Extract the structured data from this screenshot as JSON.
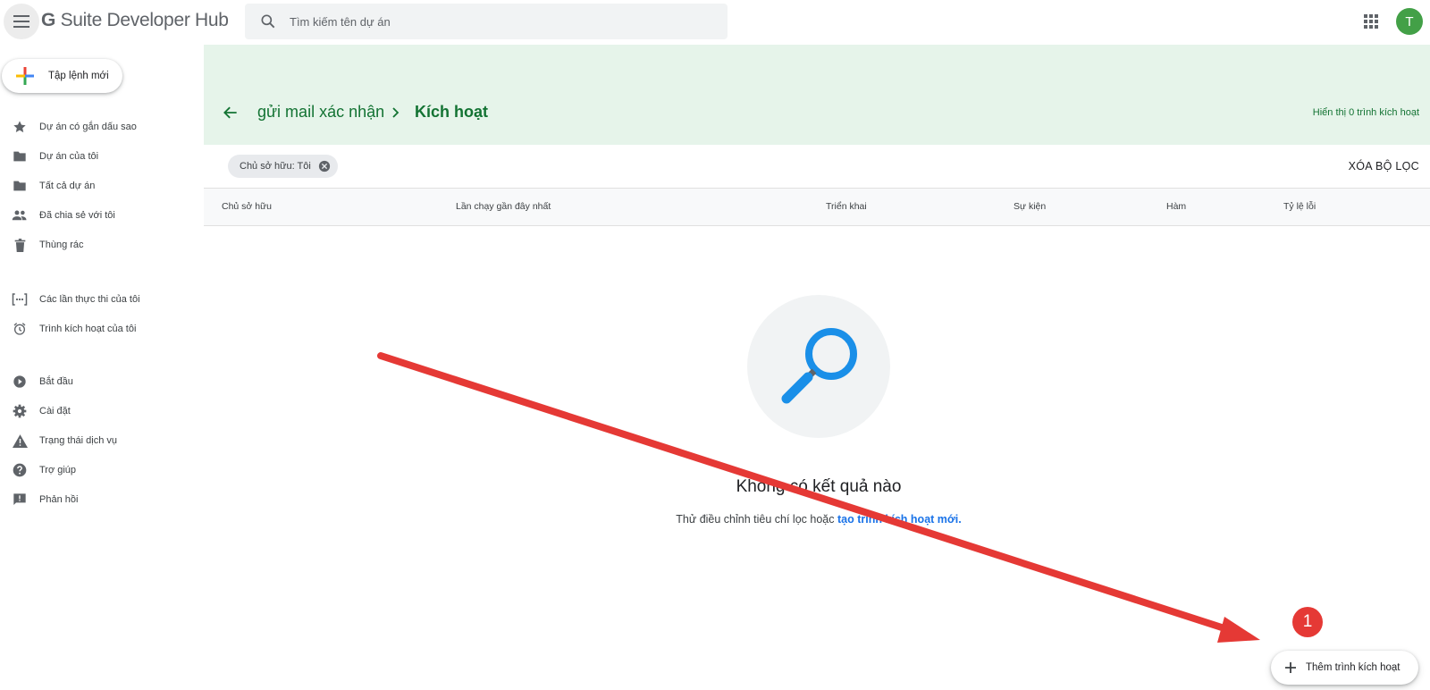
{
  "app": {
    "brand_prefix": "G",
    "brand_name": "Suite Developer Hub",
    "search_placeholder": "Tìm kiếm tên dự án",
    "avatar_initial": "T"
  },
  "sidebar": {
    "new_button_label": "Tập lệnh mới",
    "items": [
      {
        "label": "Dự án có gắn dấu sao",
        "icon": "star-icon"
      },
      {
        "label": "Dự án của tôi",
        "icon": "folder-icon"
      },
      {
        "label": "Tất cả dự án",
        "icon": "folder-icon"
      },
      {
        "label": "Đã chia sẻ với tôi",
        "icon": "people-icon"
      },
      {
        "label": "Thùng rác",
        "icon": "trash-icon"
      },
      {
        "label": "Các lần thực thi của tôi",
        "icon": "executions-icon"
      },
      {
        "label": "Trình kích hoạt của tôi",
        "icon": "alarm-icon"
      },
      {
        "label": "Bắt đầu",
        "icon": "play-circle-icon"
      },
      {
        "label": "Cài đặt",
        "icon": "gear-icon"
      },
      {
        "label": "Trạng thái dịch vụ",
        "icon": "warning-icon"
      },
      {
        "label": "Trợ giúp",
        "icon": "help-icon"
      },
      {
        "label": "Phản hồi",
        "icon": "feedback-icon"
      }
    ]
  },
  "header": {
    "project_name": "gửi mail xác nhận",
    "current_page": "Kích hoạt",
    "count_text": "Hiển thị 0 trình kích hoạt"
  },
  "filter": {
    "chip_label": "Chủ sở hữu: Tôi",
    "clear_label": "XÓA BỘ LỌC"
  },
  "table": {
    "columns": [
      "Chủ sở hữu",
      "Lần chạy gần đây nhất",
      "Triển khai",
      "Sự kiện",
      "Hàm",
      "Tỷ lệ lỗi"
    ]
  },
  "empty_state": {
    "title": "Không có kết quả nào",
    "subtitle_prefix": "Thử điều chỉnh tiêu chí lọc hoặc ",
    "subtitle_link": "tạo trình kích hoạt mới."
  },
  "fab": {
    "label": "Thêm trình kích hoạt"
  },
  "annotation": {
    "badge_number": "1",
    "color": "#e53935"
  },
  "colors": {
    "header_bg": "#e6f4ea",
    "header_text": "#137333",
    "link": "#1a73e8",
    "avatar": "#43a047"
  }
}
